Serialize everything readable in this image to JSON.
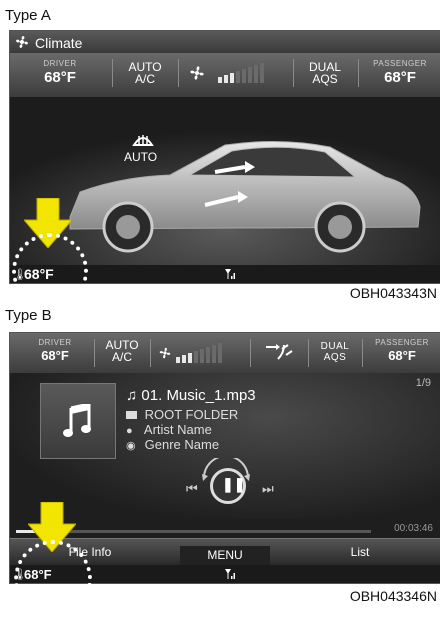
{
  "type_a": {
    "label": "Type A",
    "header_title": "Climate",
    "driver_label": "DRIVER",
    "driver_temp": "68°F",
    "auto_ac_line1": "AUTO",
    "auto_ac_line2": "A/C",
    "fan_level": 3,
    "fan_max": 8,
    "dual_line1": "DUAL",
    "dual_line2": "AQS",
    "passenger_label": "PASSENGER",
    "passenger_temp": "68°F",
    "defrost_mode": "AUTO",
    "status_temp": "68°F",
    "code": "OBH043343N"
  },
  "type_b": {
    "label": "Type B",
    "driver_label": "DRIVER",
    "driver_temp": "68°F",
    "auto_ac_line1": "AUTO",
    "auto_ac_line2": "A/C",
    "fan_level": 3,
    "fan_max": 8,
    "dual_line1": "DUAL",
    "dual_line2": "AQS",
    "passenger_label": "PASSENGER",
    "passenger_temp": "68°F",
    "track_counter": "1/9",
    "track_title": "01. Music_1.mp3",
    "folder": "ROOT FOLDER",
    "artist": "Artist Name",
    "genre": "Genre Name",
    "elapsed": "00:03:46",
    "progress": 0.1,
    "tab_file_info": "File Info",
    "tab_menu": "MENU",
    "tab_list": "List",
    "status_temp": "68°F",
    "code": "OBH043346N"
  },
  "colors": {
    "arrow": "#f2e600",
    "panel_bg": "#2a2a2a",
    "fan_on": "#e8e8e8",
    "fan_off": "#6a6a6a"
  }
}
